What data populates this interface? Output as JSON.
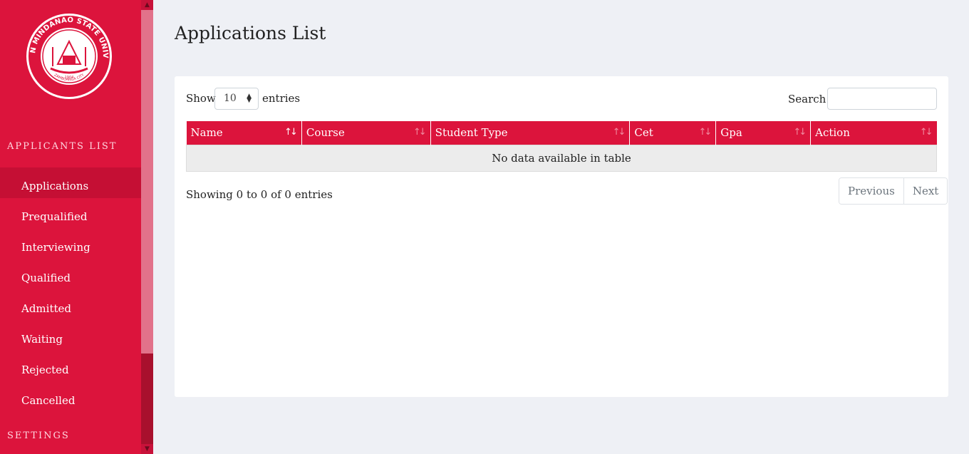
{
  "sidebar": {
    "section_applicants": "APPLICANTS LIST",
    "section_settings": "SETTINGS",
    "items": [
      {
        "label": "Applications",
        "active": true
      },
      {
        "label": "Prequalified"
      },
      {
        "label": "Interviewing"
      },
      {
        "label": "Qualified"
      },
      {
        "label": "Admitted"
      },
      {
        "label": "Waiting"
      },
      {
        "label": "Rejected"
      },
      {
        "label": "Cancelled"
      }
    ],
    "logo": {
      "name": "WESTERN MINDANAO STATE UNIVERSITY",
      "city": "ZAMBOANGA CITY",
      "year": "1904"
    }
  },
  "main": {
    "title": "Applications List",
    "show_label": "Show",
    "page_length": "10",
    "entries_label": "entries",
    "search_label": "Search:",
    "search_value": "",
    "columns": [
      "Name",
      "Course",
      "Student Type",
      "Cet",
      "Gpa",
      "Action"
    ],
    "empty_message": "No data available in table",
    "info": "Showing 0 to 0 of 0 entries",
    "pagination": {
      "previous": "Previous",
      "next": "Next"
    }
  },
  "colors": {
    "accent": "#dc143c",
    "page_background": "#eef0f5"
  }
}
